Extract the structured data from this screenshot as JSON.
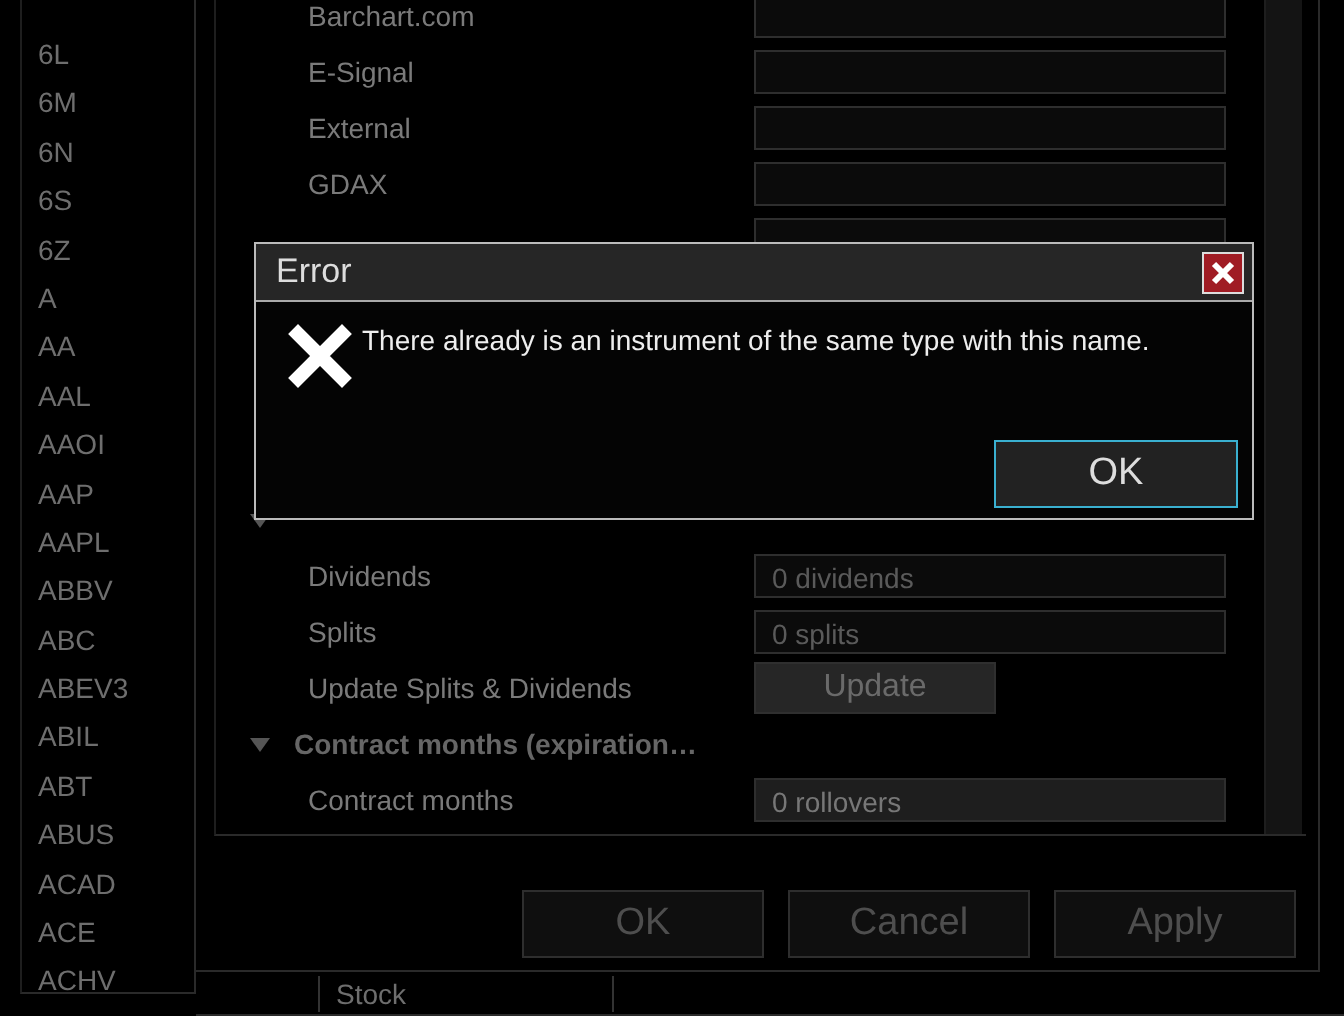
{
  "symbols": [
    "6L",
    "6M",
    "6N",
    "6S",
    "6Z",
    "A",
    "AA",
    "AAL",
    "AAOI",
    "AAP",
    "AAPL",
    "ABBV",
    "ABC",
    "ABEV3",
    "ABIL",
    "ABT",
    "ABUS",
    "ACAD",
    "ACE",
    "ACHV"
  ],
  "provider_rows": [
    {
      "kind": "field",
      "label": "Barchart.com"
    },
    {
      "kind": "field",
      "label": "E-Signal"
    },
    {
      "kind": "field",
      "label": "External"
    },
    {
      "kind": "field",
      "label": "GDAX"
    },
    {
      "kind": "field"
    }
  ],
  "section_rows": [
    {
      "kind": "category",
      "expanded": true
    },
    {
      "kind": "field",
      "label": "Dividends",
      "value": "0 dividends"
    },
    {
      "kind": "field",
      "label": "Splits",
      "value": "0 splits"
    },
    {
      "kind": "button",
      "label": "Update Splits & Dividends",
      "button": "Update",
      "disabled": true
    },
    {
      "kind": "category",
      "label": "Contract months (expiration…",
      "expanded": true
    },
    {
      "kind": "field",
      "label": "Contract months",
      "value": "0 rollovers",
      "disabled": true
    }
  ],
  "buttons": [
    {
      "label": "OK"
    },
    {
      "label": "Cancel"
    },
    {
      "label": "Apply"
    }
  ],
  "type_cell": "Stock",
  "dialog": {
    "title": "Error",
    "message": "There already is an instrument of the same type with this name.",
    "button": {
      "label": "OK",
      "focused": true
    }
  }
}
